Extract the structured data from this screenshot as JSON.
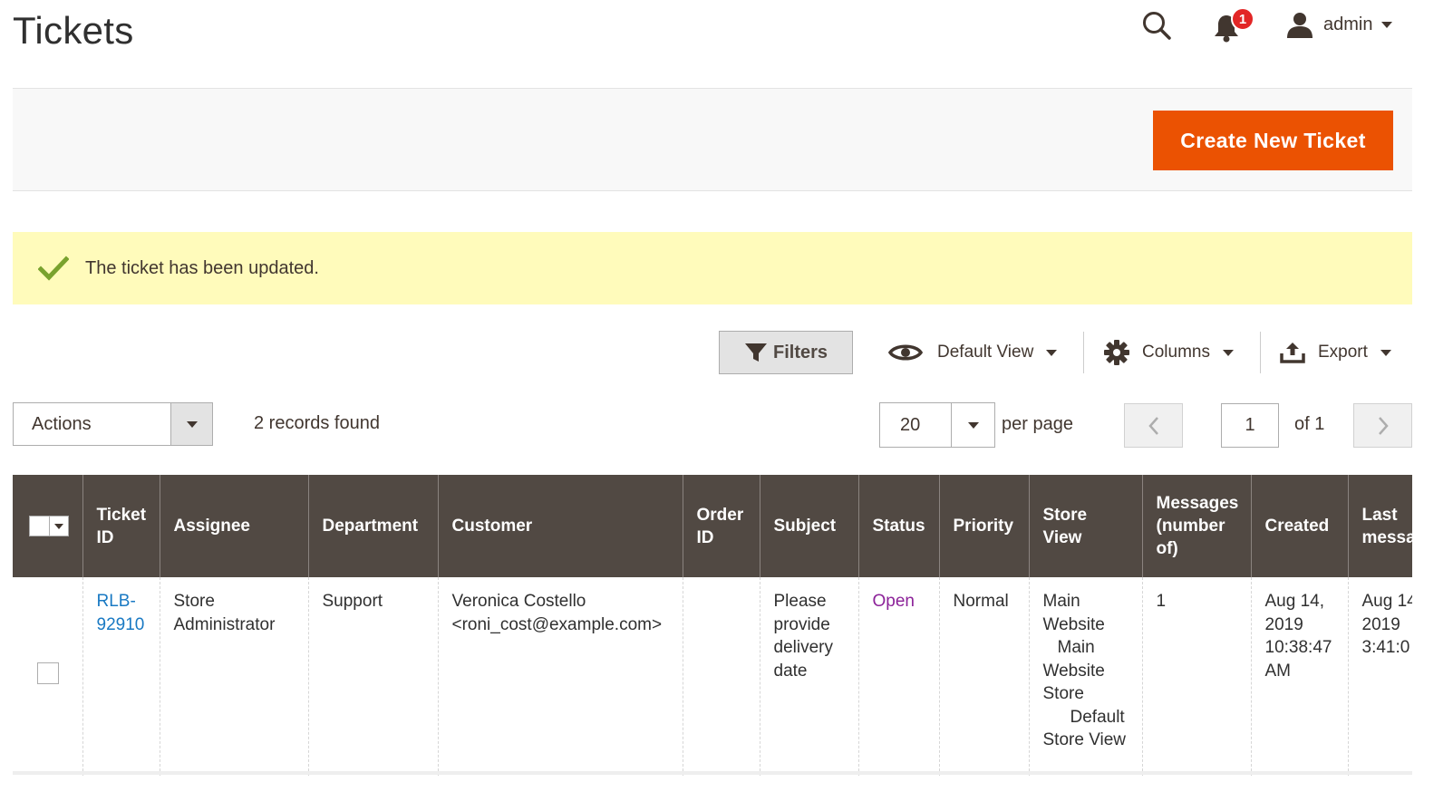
{
  "header": {
    "title": "Tickets",
    "notifications_count": "1",
    "user_name": "admin"
  },
  "action_bar": {
    "create_label": "Create New Ticket"
  },
  "message": {
    "text": "The ticket has been updated."
  },
  "toolbar": {
    "filters_label": "Filters",
    "view_label": "Default View",
    "columns_label": "Columns",
    "export_label": "Export",
    "actions_label": "Actions",
    "records_found": "2 records found",
    "per_page_value": "20",
    "per_page_label": "per page",
    "current_page": "1",
    "page_of": "of 1"
  },
  "grid": {
    "columns": {
      "ticket_id": [
        "Ticket",
        "ID"
      ],
      "assignee": "Assignee",
      "department": "Department",
      "customer": "Customer",
      "order_id": [
        "Order",
        "ID"
      ],
      "subject": "Subject",
      "status": "Status",
      "priority": "Priority",
      "store_view": [
        "Store",
        "View"
      ],
      "messages": [
        "Messages",
        "(number",
        "of)"
      ],
      "created": "Created",
      "last_message": [
        "Last",
        "messa"
      ]
    },
    "rows": [
      {
        "ticket_id": [
          "RLB-",
          "92910"
        ],
        "assignee": [
          "Store",
          "Administrator"
        ],
        "department": "Support",
        "customer": [
          "Veronica Costello",
          "<roni_cost@example.com>"
        ],
        "order_id": "",
        "subject": [
          "Please",
          "provide",
          "delivery",
          "date"
        ],
        "status": "Open",
        "priority": "Normal",
        "store_view": [
          "Main",
          "Website",
          "Main",
          "Website",
          "Store",
          "Default",
          "Store View"
        ],
        "messages": "1",
        "created": [
          "Aug 14,",
          "2019",
          "10:38:47",
          "AM"
        ],
        "last_message": [
          "Aug 14",
          "2019",
          "3:41:0"
        ]
      }
    ]
  },
  "colors": {
    "accent": "#eb5202",
    "header_bg": "#514943",
    "message_bg": "#fffbbb",
    "success": "#79a22e",
    "link": "#1979c3",
    "status_open": "#8c2299",
    "badge": "#e22626"
  },
  "icons": {
    "search": "search-icon",
    "bell": "bell-icon",
    "user": "user-icon",
    "check": "check-icon",
    "filter": "filter-icon",
    "eye": "eye-icon",
    "gear": "gear-icon",
    "export": "export-icon"
  }
}
